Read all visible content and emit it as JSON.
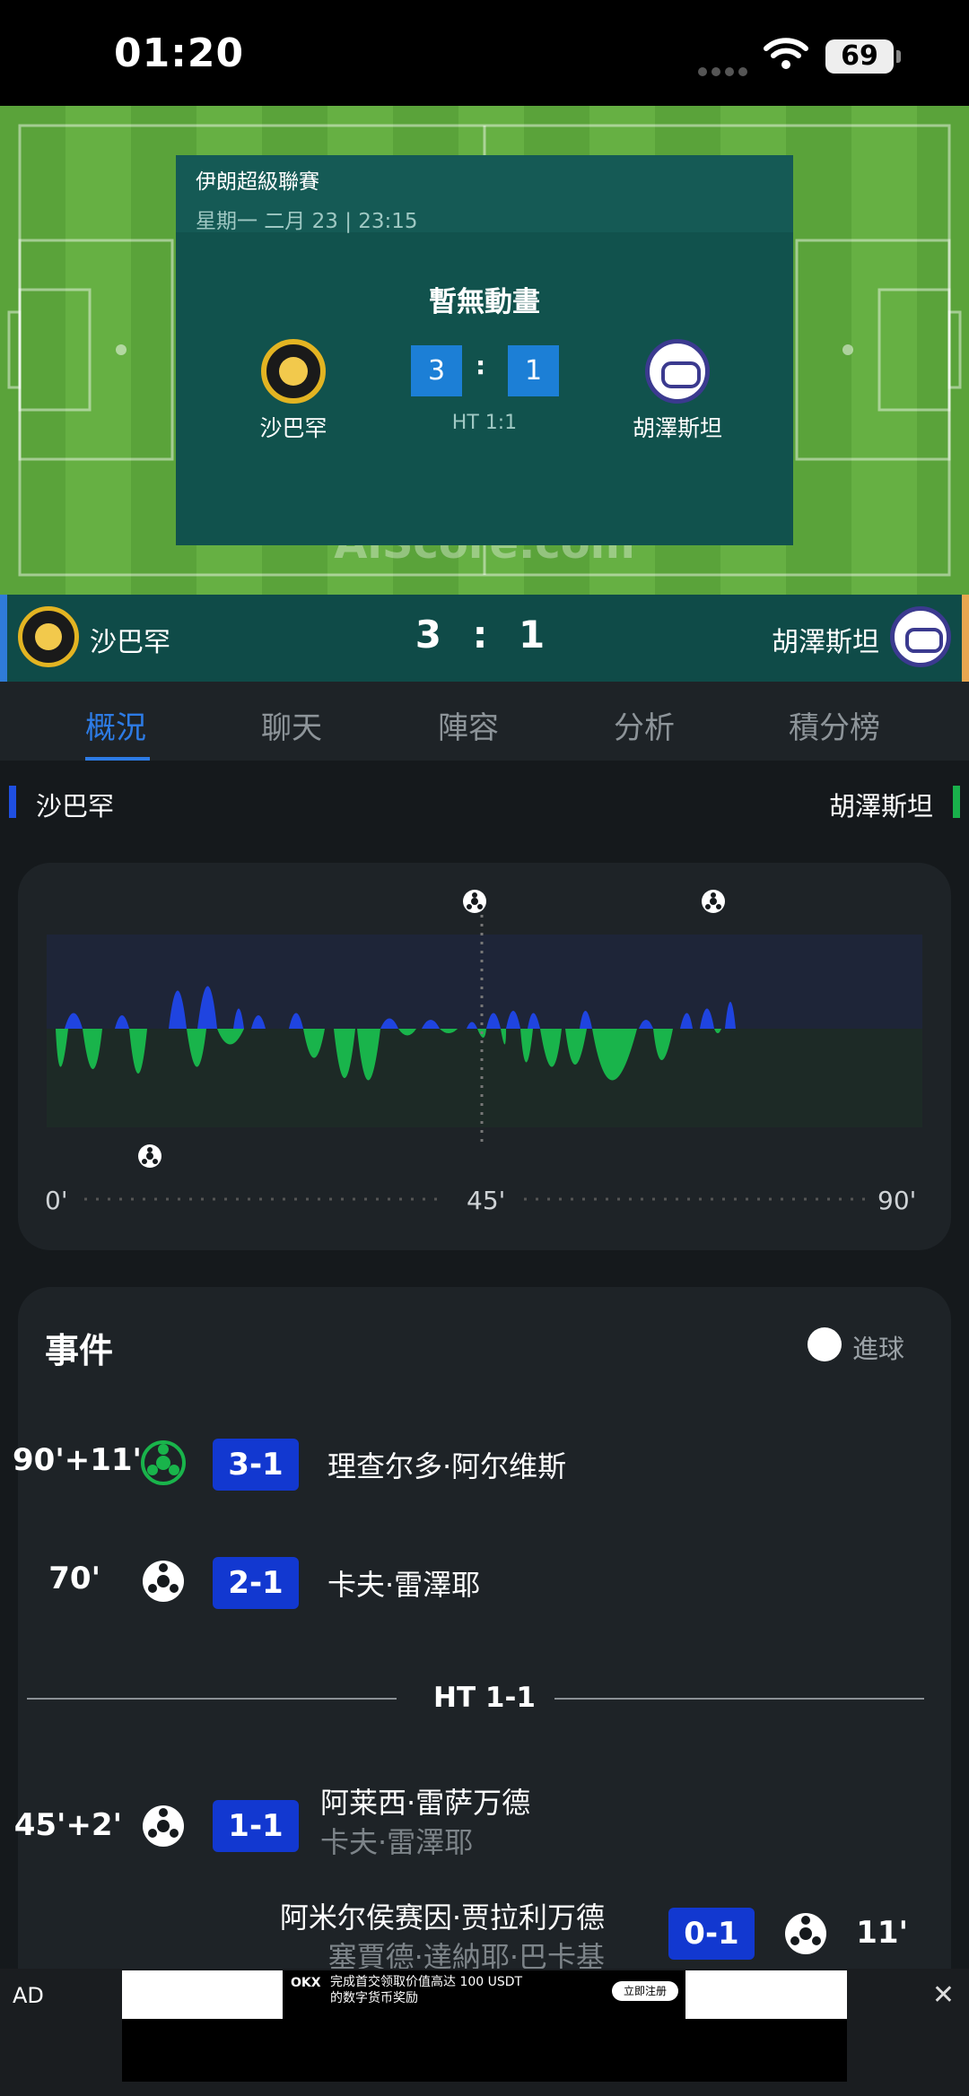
{
  "status_bar": {
    "time": "01:20",
    "battery": "69"
  },
  "match_card": {
    "league": "伊朗超級聯賽",
    "datetime": "星期一 二月 23 | 23:15",
    "animation_note": "暫無動畫",
    "home_team": "沙巴罕",
    "away_team": "胡澤斯坦",
    "home_score": "3",
    "colon": ":",
    "away_score": "1",
    "halftime": "HT 1:1",
    "watermark": "AiScore.com"
  },
  "score_bar": {
    "home_team": "沙巴罕",
    "score": "3 : 1",
    "away_team": "胡澤斯坦"
  },
  "tabs": [
    {
      "label": "概況",
      "active": true
    },
    {
      "label": "聊天",
      "active": false
    },
    {
      "label": "陣容",
      "active": false
    },
    {
      "label": "分析",
      "active": false
    },
    {
      "label": "積分榜",
      "active": false
    }
  ],
  "teams_row": {
    "home": "沙巴罕",
    "away": "胡澤斯坦"
  },
  "momentum": {
    "axis_labels": [
      "0'",
      "45'",
      "90'"
    ],
    "home_color": "#1f4fe0",
    "away_color": "#19b04b"
  },
  "events": {
    "title": "事件",
    "legend_label": "進球",
    "halftime_label": "HT 1-1",
    "items": [
      {
        "minute": "90'+11'",
        "score": "3-1",
        "player": "理查尔多·阿尔维斯",
        "assist": "",
        "icon": "goal-ball-icon"
      },
      {
        "minute": "70'",
        "score": "2-1",
        "player": "卡夫·雷澤耶",
        "assist": "",
        "icon": "goal-ball-icon"
      },
      {
        "minute": "45'+2'",
        "score": "1-1",
        "player": "阿莱西·雷萨万德",
        "assist": "卡夫·雷澤耶",
        "icon": "goal-ball-icon"
      },
      {
        "minute": "11'",
        "score": "0-1",
        "player": "阿米尔侯赛因·贾拉利万德",
        "assist": "塞賈德·達納耶·巴卡基",
        "icon": "goal-ball-icon"
      }
    ]
  },
  "ad": {
    "tag": "AD",
    "close": "✕",
    "brand": "OKX",
    "text_line1": "完成首交领取价值高达 100 USDT",
    "text_line2": "的数字货币奖励",
    "button": "立即注册"
  }
}
